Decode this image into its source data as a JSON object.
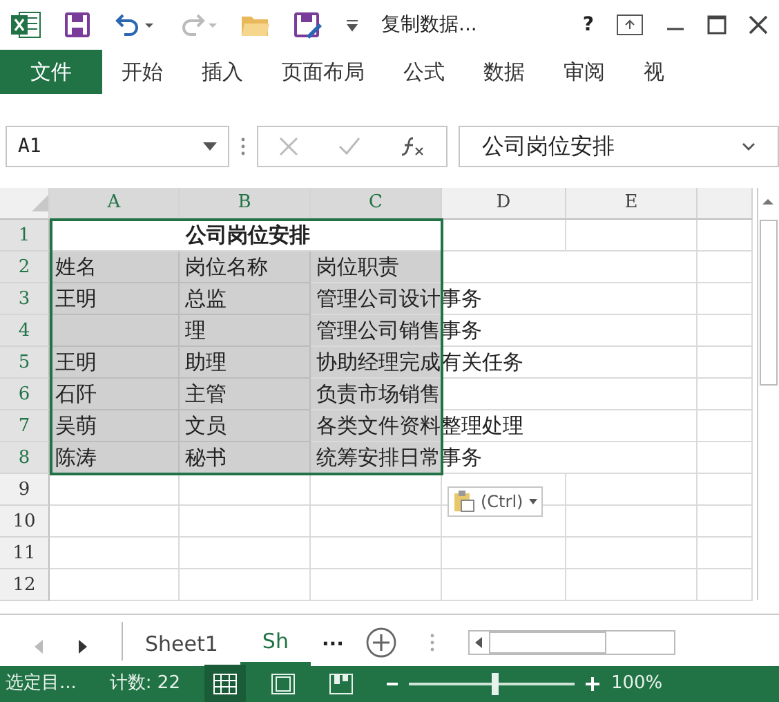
{
  "title_bar": {
    "title": "复制数据...",
    "help": "?"
  },
  "ribbon_tabs": [
    {
      "label": "文件",
      "selected": true
    },
    {
      "label": "开始",
      "selected": false
    },
    {
      "label": "插入",
      "selected": false
    },
    {
      "label": "页面布局",
      "selected": false
    },
    {
      "label": "公式",
      "selected": false
    },
    {
      "label": "数据",
      "selected": false
    },
    {
      "label": "审阅",
      "selected": false
    },
    {
      "label": "视",
      "selected": false
    }
  ],
  "name_box": {
    "value": "A1"
  },
  "formula_bar": {
    "value": "公司岗位安排"
  },
  "sheet": {
    "columns": [
      "A",
      "B",
      "C",
      "D",
      "E"
    ],
    "rows": [
      {
        "number": "1",
        "kind": "title",
        "text": "公司岗位安排"
      },
      {
        "number": "2",
        "kind": "data",
        "cells": [
          "姓名",
          "岗位名称",
          "岗位职责"
        ]
      },
      {
        "number": "3",
        "kind": "data",
        "cells": [
          "王明",
          "总监",
          "管理公司设计事务"
        ]
      },
      {
        "number": "4",
        "kind": "data",
        "cells": [
          "",
          "理",
          "管理公司销售事务"
        ]
      },
      {
        "number": "5",
        "kind": "data",
        "cells": [
          "王明",
          "助理",
          "协助经理完成有关任务"
        ]
      },
      {
        "number": "6",
        "kind": "data",
        "cells": [
          "石阡",
          "主管",
          "负责市场销售"
        ]
      },
      {
        "number": "7",
        "kind": "data",
        "cells": [
          "吴萌",
          "文员",
          "各类文件资料整理处理"
        ]
      },
      {
        "number": "8",
        "kind": "data",
        "cells": [
          "陈涛",
          "秘书",
          "统筹安排日常事务"
        ]
      },
      {
        "number": "9",
        "kind": "empty"
      },
      {
        "number": "10",
        "kind": "empty"
      },
      {
        "number": "11",
        "kind": "empty"
      },
      {
        "number": "12",
        "kind": "empty"
      }
    ],
    "paste_options": {
      "label": "(Ctrl)"
    }
  },
  "sheet_tabs": [
    {
      "label": "Sheet1",
      "selected": false
    },
    {
      "label": "Sh",
      "selected": true
    }
  ],
  "more_sheets": "...",
  "status_bar": {
    "mode": "选定目...",
    "count": "计数: 22",
    "zoom": {
      "level": 0.5,
      "reading": "100%"
    }
  }
}
